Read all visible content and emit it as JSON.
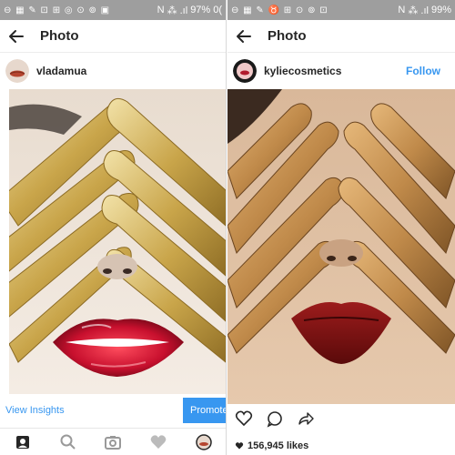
{
  "left": {
    "status": {
      "icons": "⊖ ▦ ✎ ⊡ ⊞ ◎ ⊙ ⊚ ▣",
      "battery": "97%",
      "carrier": "N",
      "signal": "⁂ .ıl",
      "time_fragment": "0("
    },
    "appbar": {
      "title": "Photo"
    },
    "post": {
      "username": "vladamua"
    },
    "actions": {
      "insights_label": "View Insights",
      "promote_label": "Promote"
    },
    "tabs": [
      "home",
      "search",
      "camera",
      "activity",
      "profile"
    ]
  },
  "right": {
    "status": {
      "icons": "⊖ ▦ ✎ ♉ ⊞ ⊙ ⊚ ⊡",
      "battery": "99%",
      "carrier": "N",
      "signal": "⁂ .ıl"
    },
    "appbar": {
      "title": "Photo"
    },
    "post": {
      "username": "kyliecosmetics",
      "follow_label": "Follow"
    },
    "likes": "156,945 likes"
  },
  "colors": {
    "accent": "#3897f0",
    "text": "#262626",
    "status_bg": "#9e9e9e",
    "lip_gloss": "#c8102e",
    "lip_matte": "#7a1010",
    "gold": "#c9a54a"
  }
}
